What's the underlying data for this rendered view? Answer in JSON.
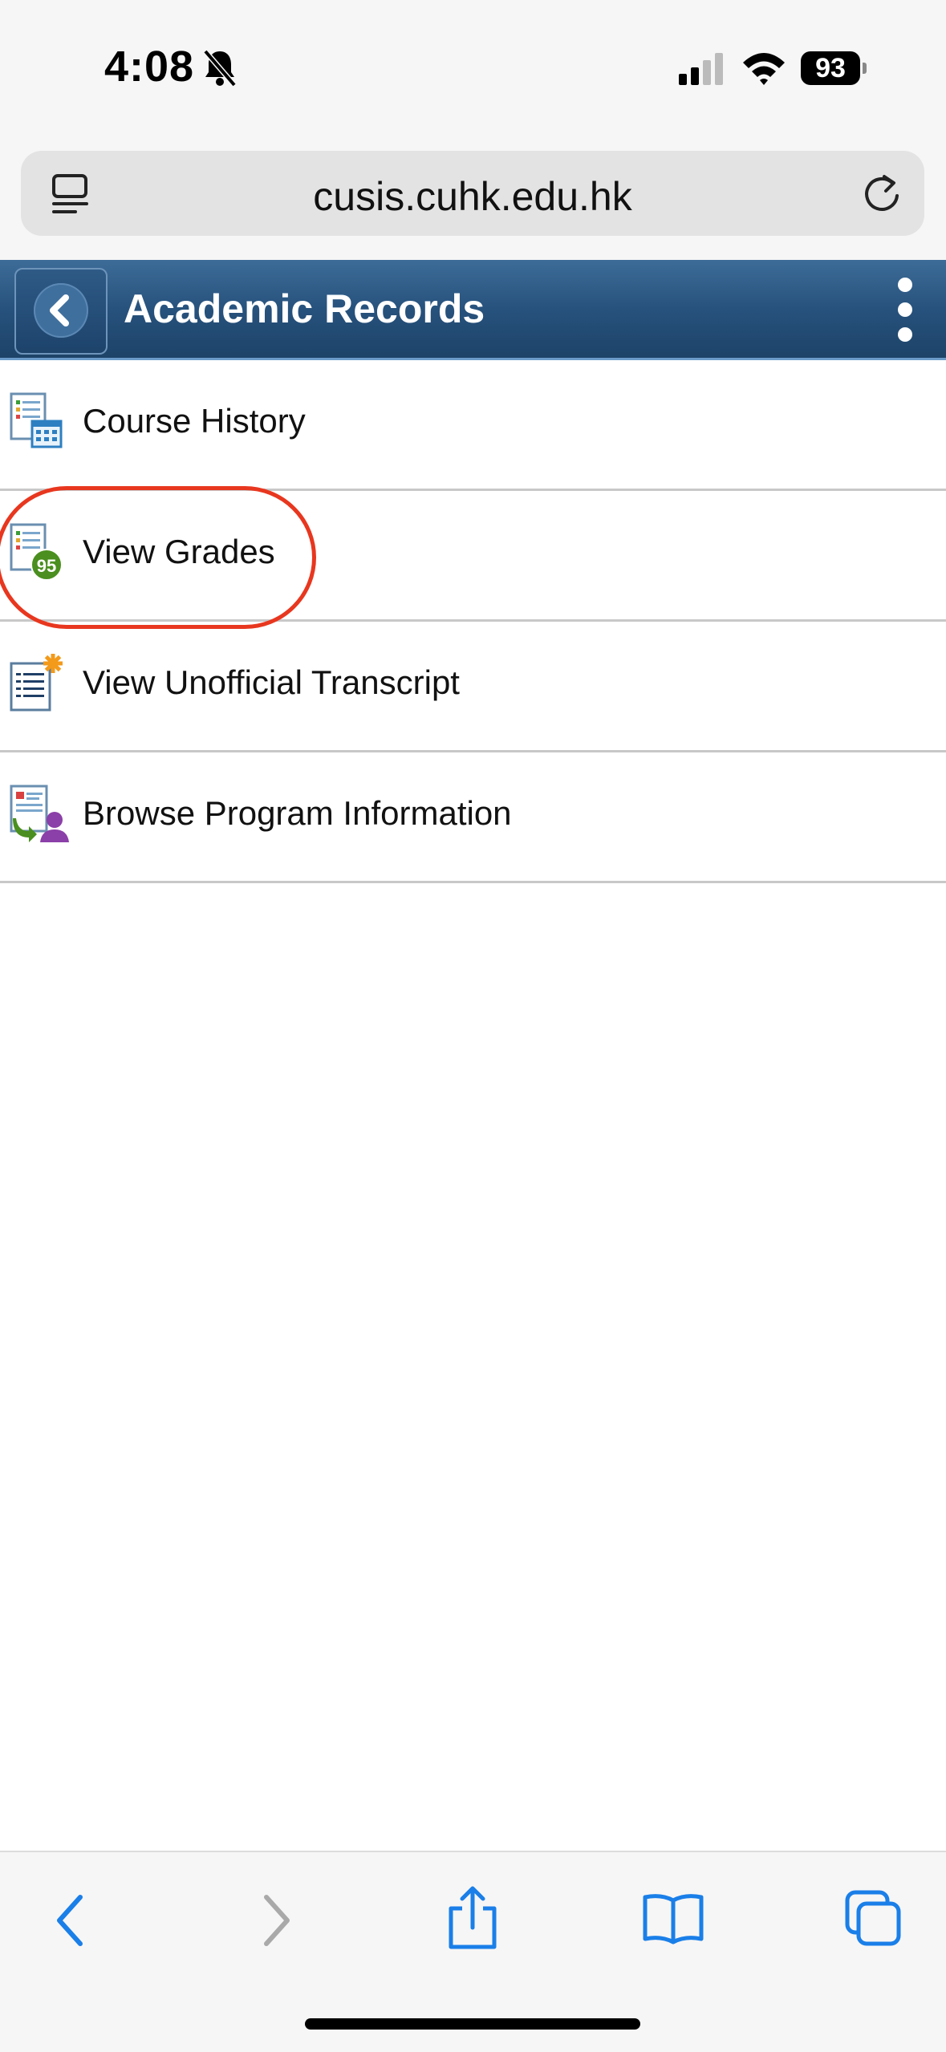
{
  "status": {
    "time": "4:08",
    "battery": "93"
  },
  "browser": {
    "url": "cusis.cuhk.edu.hk"
  },
  "header": {
    "title": "Academic Records"
  },
  "menu": {
    "items": [
      {
        "label": "Course History",
        "icon": "course-history-icon"
      },
      {
        "label": "View Grades",
        "icon": "view-grades-icon",
        "badge": "95"
      },
      {
        "label": "View Unofficial Transcript",
        "icon": "transcript-icon"
      },
      {
        "label": "Browse Program Information",
        "icon": "program-info-icon"
      }
    ]
  },
  "colors": {
    "header": "#27527d",
    "highlight": "#e8371f",
    "accent": "#1a7fe8"
  }
}
